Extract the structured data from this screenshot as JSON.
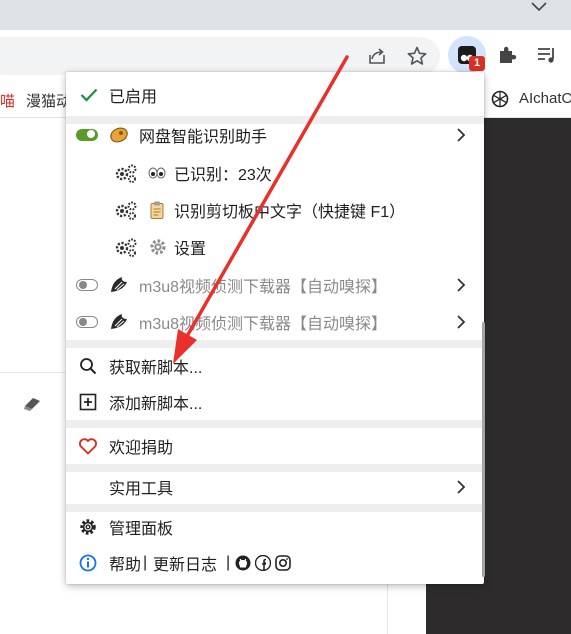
{
  "bookmarks": {
    "item_1": "喵",
    "item_2": "漫猫动",
    "item_3": "AIchatO"
  },
  "extension_badge": "1",
  "menu": {
    "enabled_label": "已启用",
    "script_1": {
      "name": "网盘智能识别助手",
      "subitems": [
        {
          "label": "已识别：23次"
        },
        {
          "label": "识别剪切板中文字（快捷键 F1）"
        },
        {
          "label": "设置"
        }
      ]
    },
    "script_2": {
      "name": "m3u8视频侦测下载器【自动嗅探】"
    },
    "script_3": {
      "name": "m3u8视频侦测下载器【自动嗅探】"
    },
    "get_new_script": "获取新脚本...",
    "add_new_script": "添加新脚本...",
    "donate": "欢迎捐助",
    "utilities": "实用工具",
    "dashboard": "管理面板",
    "help": "帮助",
    "changelog": "更新日志",
    "separator": "|"
  },
  "colors": {
    "accent_green": "#1e8e3e",
    "toggle_on": "#5a9a2b",
    "heart_red": "#d93025",
    "info_blue": "#1a73e8",
    "arrow_red": "#e8312a",
    "badge_red": "#d93025"
  },
  "icons": [
    "share-icon",
    "star-icon",
    "extension-puzzle-icon",
    "reading-list-icon",
    "check-icon",
    "gear-icon",
    "eyes-icon",
    "clipboard-icon",
    "search-icon",
    "plus-box-icon",
    "heart-icon",
    "info-icon",
    "github-icon",
    "facebook-icon",
    "instagram-icon",
    "eraser-icon",
    "openai-icon"
  ]
}
